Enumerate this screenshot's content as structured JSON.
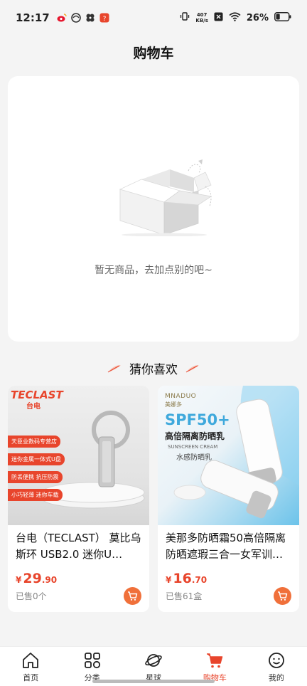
{
  "status_bar": {
    "time": "12:17",
    "net_speed_value": "407",
    "net_speed_unit": "KB/s",
    "battery": "26%",
    "apps": [
      {
        "icon": "weibo-icon",
        "color": "#e6162d"
      },
      {
        "icon": "app-circle-icon",
        "color": "#333333"
      },
      {
        "icon": "app-flower-icon",
        "color": "#333333"
      },
      {
        "icon": "app-red-square-icon",
        "color": "#e8452c"
      }
    ]
  },
  "page": {
    "title": "购物车"
  },
  "cart": {
    "empty_text": "暂无商品，去加点别的吧~"
  },
  "recommend": {
    "title": "猜你喜欢",
    "products": [
      {
        "name": "台电（TECLAST） 莫比乌斯环 USB2.0 迷你U…",
        "price_symbol": "¥",
        "price_int": "29",
        "price_dec": ".90",
        "sold": "已售0个",
        "image": {
          "brand": "TECLAST",
          "brand_cn": "台电",
          "tags": [
            "天臣业数码专营店",
            "迷你金属一体式U盘",
            "防丢便携 抗压防震",
            "小巧轻薄 迷你车载"
          ]
        }
      },
      {
        "name": "美那多防晒霜50高倍隔离防晒遮瑕三合一女军训…",
        "price_symbol": "¥",
        "price_int": "16",
        "price_dec": ".70",
        "sold": "已售61盒",
        "image": {
          "brand": "MNADUO",
          "brand_cn": "美娜多",
          "spf": "SPF50+",
          "line1": "高倍隔离防晒乳",
          "line2": "SUNSCREEN CREAM",
          "line3": "水感防晒乳"
        }
      }
    ]
  },
  "tab_bar": {
    "items": [
      {
        "label": "首页",
        "icon": "home-icon"
      },
      {
        "label": "分类",
        "icon": "category-icon"
      },
      {
        "label": "星球",
        "icon": "planet-icon"
      },
      {
        "label": "购物车",
        "icon": "cart-icon",
        "active": true
      },
      {
        "label": "我的",
        "icon": "profile-icon"
      }
    ]
  },
  "colors": {
    "accent": "#e8452c",
    "cart_button": "#f0703a",
    "background": "#f4f4f4"
  }
}
